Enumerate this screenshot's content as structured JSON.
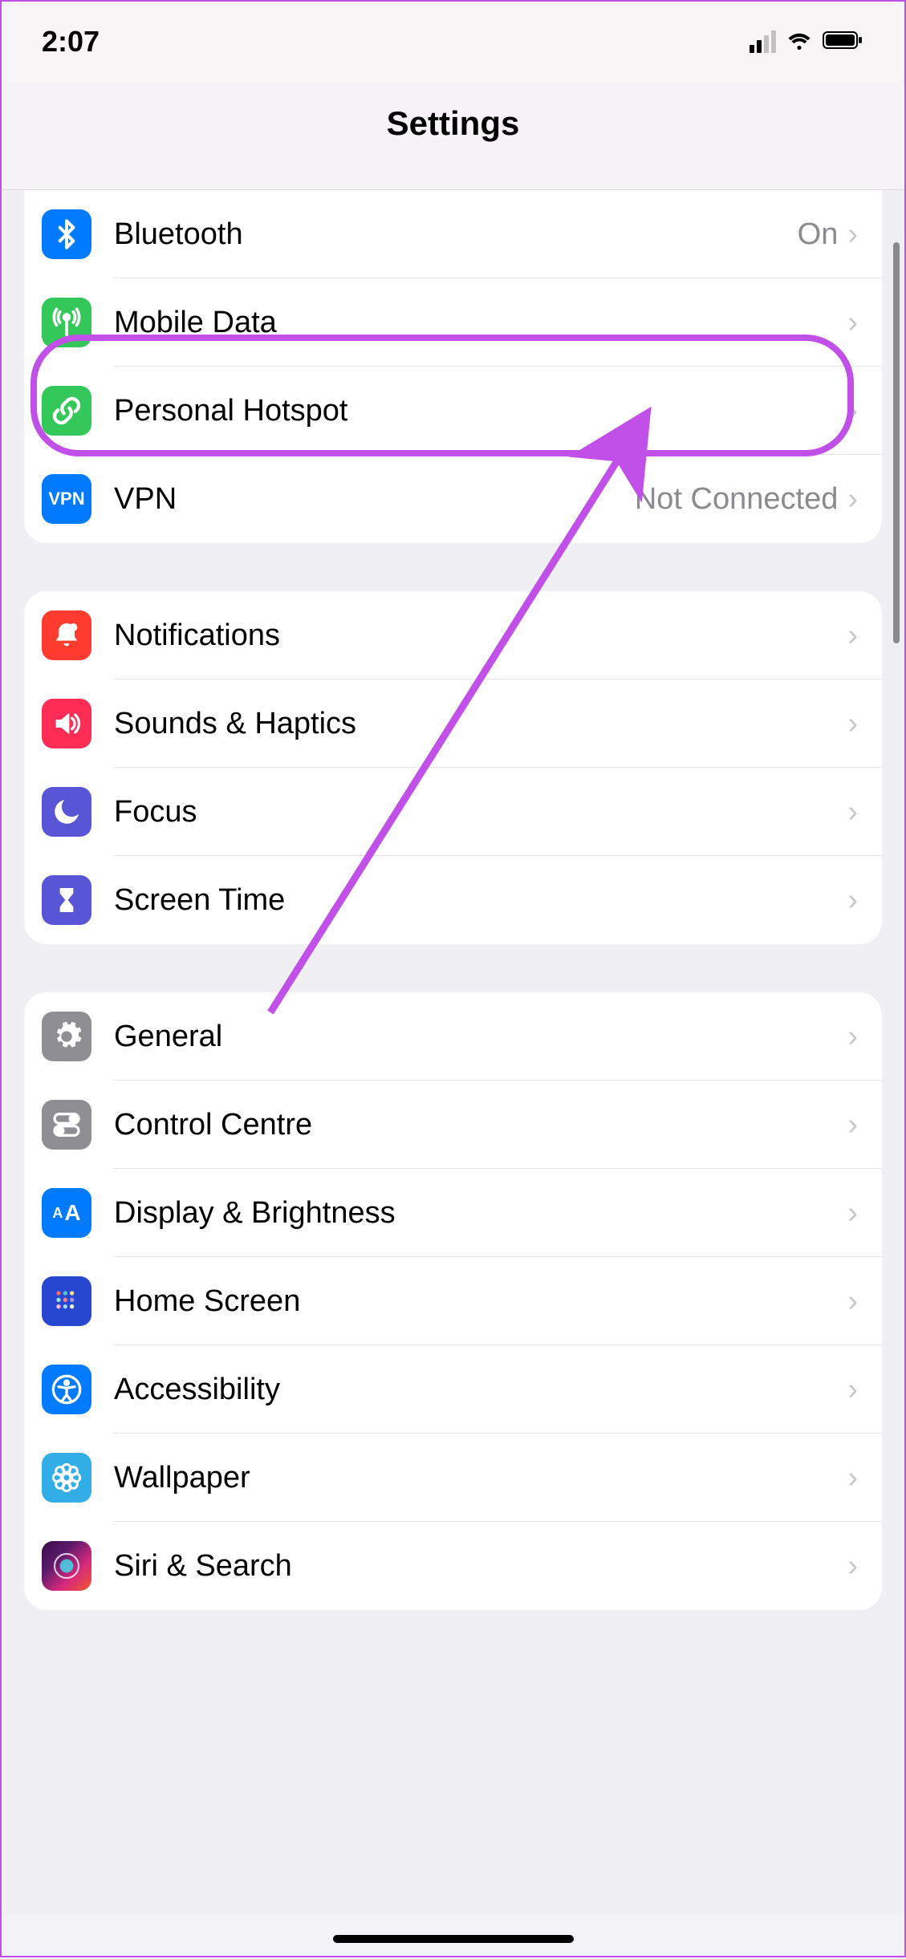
{
  "status": {
    "time": "2:07"
  },
  "nav": {
    "title": "Settings"
  },
  "groups": [
    {
      "id": "connectivity",
      "first": true,
      "items": [
        {
          "id": "bluetooth",
          "label": "Bluetooth",
          "value": "On",
          "icon": "bluetooth",
          "color": "blue"
        },
        {
          "id": "mobile-data",
          "label": "Mobile Data",
          "value": "",
          "icon": "antenna",
          "color": "green",
          "highlighted": true
        },
        {
          "id": "personal-hotspot",
          "label": "Personal Hotspot",
          "value": "",
          "icon": "link",
          "color": "green"
        },
        {
          "id": "vpn",
          "label": "VPN",
          "value": "Not Connected",
          "icon": "vpn-text",
          "color": "blue"
        }
      ]
    },
    {
      "id": "alerts",
      "items": [
        {
          "id": "notifications",
          "label": "Notifications",
          "value": "",
          "icon": "bell",
          "color": "red"
        },
        {
          "id": "sounds-haptics",
          "label": "Sounds & Haptics",
          "value": "",
          "icon": "speaker",
          "color": "pink"
        },
        {
          "id": "focus",
          "label": "Focus",
          "value": "",
          "icon": "moon",
          "color": "indigo"
        },
        {
          "id": "screen-time",
          "label": "Screen Time",
          "value": "",
          "icon": "hourglass",
          "color": "indigo"
        }
      ]
    },
    {
      "id": "general-group",
      "items": [
        {
          "id": "general",
          "label": "General",
          "value": "",
          "icon": "gear",
          "color": "gray"
        },
        {
          "id": "control-centre",
          "label": "Control Centre",
          "value": "",
          "icon": "switches",
          "color": "gray"
        },
        {
          "id": "display-brightness",
          "label": "Display & Brightness",
          "value": "",
          "icon": "text-size",
          "color": "blue"
        },
        {
          "id": "home-screen",
          "label": "Home Screen",
          "value": "",
          "icon": "grid",
          "color": "blue-dark"
        },
        {
          "id": "accessibility",
          "label": "Accessibility",
          "value": "",
          "icon": "accessibility",
          "color": "blue"
        },
        {
          "id": "wallpaper",
          "label": "Wallpaper",
          "value": "",
          "icon": "flower",
          "color": "cyan"
        },
        {
          "id": "siri-search",
          "label": "Siri & Search",
          "value": "",
          "icon": "siri",
          "color": "siri"
        }
      ]
    }
  ],
  "annotation": {
    "highlight_target": "mobile-data"
  }
}
